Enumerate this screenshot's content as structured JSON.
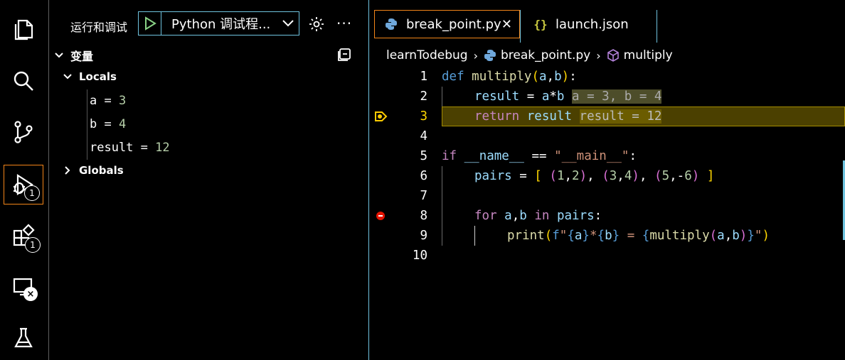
{
  "sidebar": {
    "title": "运行和调试",
    "config_label": "Python 调试程...",
    "variables_title": "变量",
    "locals_label": "Locals",
    "globals_label": "Globals",
    "locals": [
      {
        "name": "a",
        "value": "3"
      },
      {
        "name": "b",
        "value": "4"
      },
      {
        "name": "result",
        "value": "12"
      }
    ]
  },
  "activity": {
    "debug_badge": "1",
    "extensions_badge": "1"
  },
  "tabs": [
    {
      "label": "break_point.py",
      "active": true,
      "icon": "python-icon"
    },
    {
      "label": "launch.json",
      "active": false,
      "icon": "json-icon"
    }
  ],
  "breadcrumb": {
    "folder": "learnTodebug",
    "file": "break_point.py",
    "symbol": "multiply"
  },
  "editor": {
    "line_numbers": [
      "1",
      "2",
      "3",
      "4",
      "5",
      "6",
      "7",
      "8",
      "9",
      "10"
    ],
    "inline_values": {
      "line2": "a = 3, b = 4",
      "line3": "result = 12"
    },
    "current_line": 3,
    "breakpoint_line": 8
  },
  "colors": {
    "focus_border": "#f38518",
    "contrast_border": "#6fc3df",
    "breakpoint": "#e51400",
    "current_line_bg": "#4b4000"
  }
}
